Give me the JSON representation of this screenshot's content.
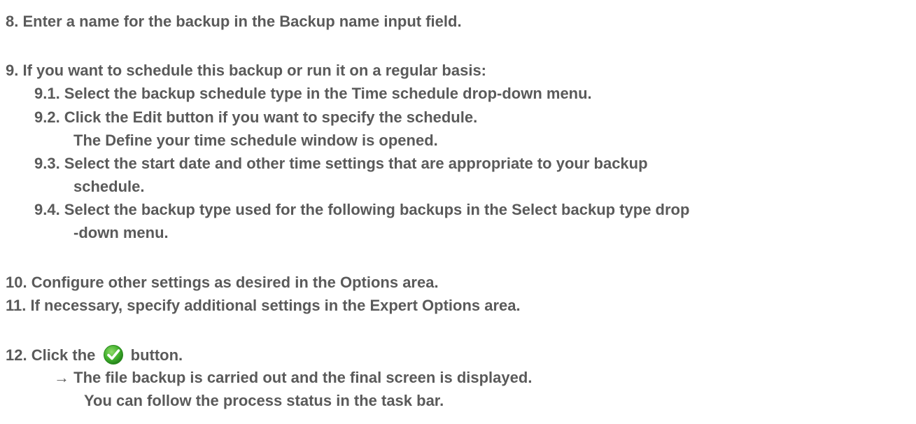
{
  "steps": {
    "s8": "8. Enter a name for the backup in the Backup name input field.",
    "s9": "9. If you want to schedule this backup or run it on a regular basis:",
    "s9_1": "9.1. Select the backup schedule type in the Time schedule drop-down menu.",
    "s9_2": "9.2. Click the Edit button if you want to specify the schedule.",
    "s9_2_note": "The Define your time schedule window is opened.",
    "s9_3_a": "9.3. Select the start date and other time settings that are appropriate to your backup",
    "s9_3_b": "schedule.",
    "s9_4_a": "9.4. Select the backup type used for the following backups in the Select backup type drop",
    "s9_4_b": "-down menu.",
    "s10": "10. Configure other settings as desired in the Options area.",
    "s11": "11. If necessary, specify additional settings in the Expert Options area.",
    "s12_prefix": "12. Click the",
    "s12_suffix": "button.",
    "result_arrow": "→",
    "result_1": "The file backup is carried out and the final screen is displayed.",
    "result_2": "You can follow the process status in the task bar."
  },
  "icons": {
    "confirm_button": "green-checkmark-icon"
  },
  "colors": {
    "text": "#5a5a5a",
    "check_green": "#3fae2a"
  }
}
